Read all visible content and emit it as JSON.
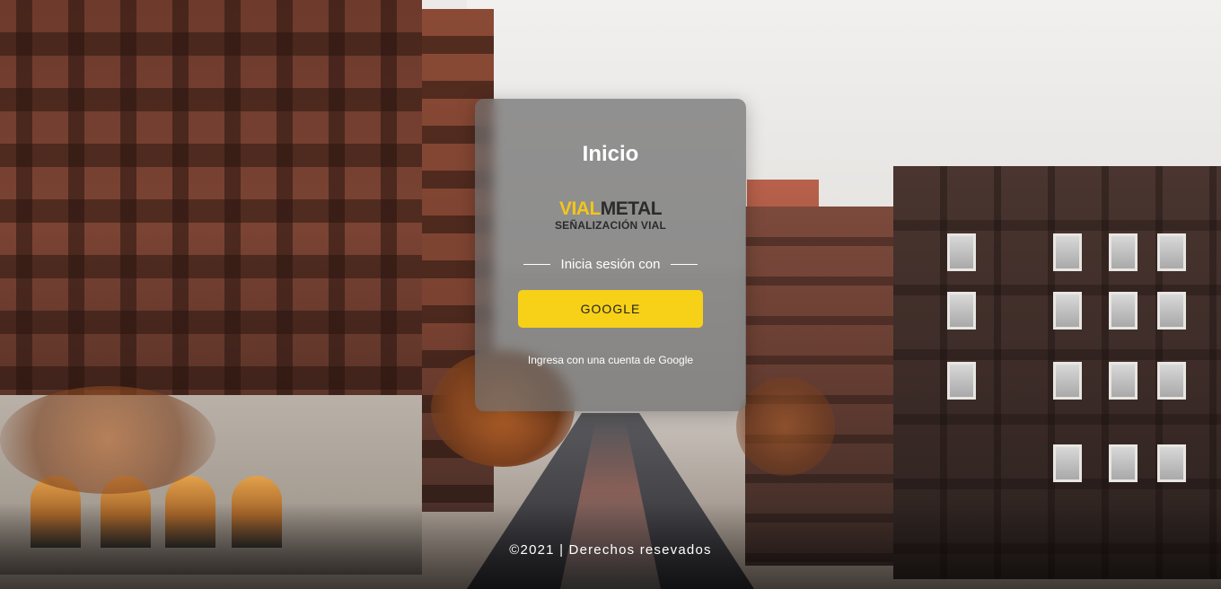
{
  "login": {
    "title": "Inicio",
    "logo": {
      "brand_part1": "VIAL",
      "brand_part2": "METAL",
      "tagline": "SEÑALIZACIÓN VIAL"
    },
    "divider_text": "Inicia sesión con",
    "google_button_label": "GOOGLE",
    "hint": "Ingresa con una cuenta de Google"
  },
  "footer": {
    "text": "©2021 | Derechos resevados"
  },
  "colors": {
    "accent": "#f7d117",
    "logo_yellow": "#f5c518",
    "logo_dark": "#2b2b2b"
  }
}
